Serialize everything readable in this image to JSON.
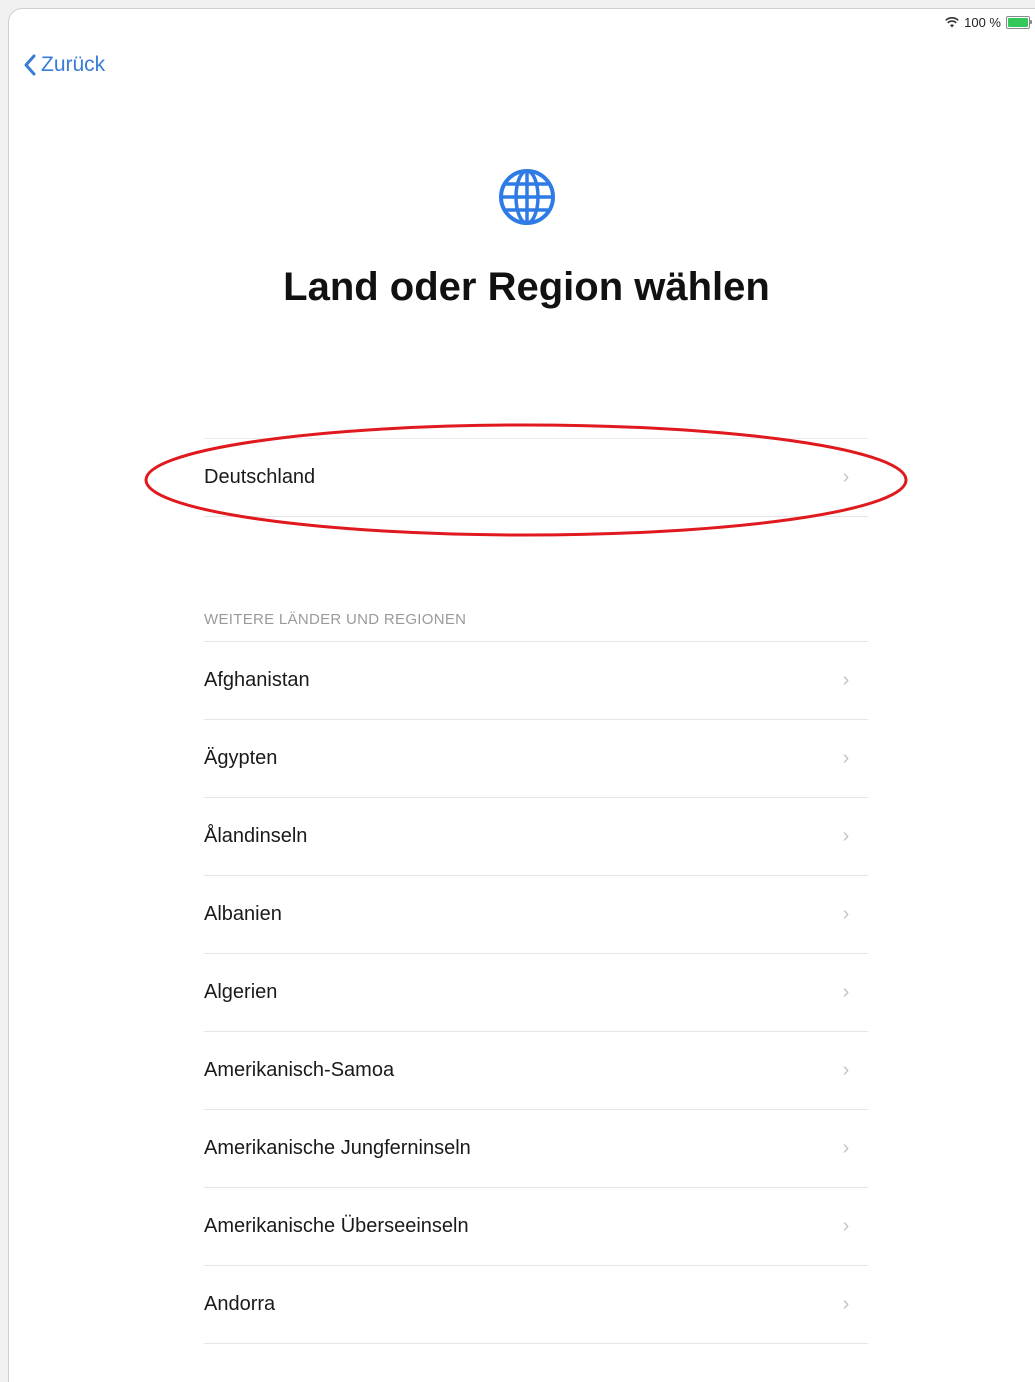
{
  "status_bar": {
    "battery_text": "100 %",
    "battery_level": 1.0,
    "wifi_icon": "wifi-icon",
    "battery_icon": "battery-icon",
    "battery_color": "#34c759"
  },
  "nav": {
    "back_label": "Zurück",
    "back_icon": "chevron-left-icon",
    "accent_color": "#3a7bd5"
  },
  "header": {
    "icon": "globe-icon",
    "title": "Land oder Region wählen"
  },
  "suggested": {
    "items": [
      {
        "label": "Deutschland"
      }
    ],
    "highlight_color": "#e0191f"
  },
  "more_regions": {
    "section_title": "WEITERE LÄNDER UND REGIONEN",
    "items": [
      {
        "label": "Afghanistan"
      },
      {
        "label": "Ägypten"
      },
      {
        "label": "Ålandinseln"
      },
      {
        "label": "Albanien"
      },
      {
        "label": "Algerien"
      },
      {
        "label": "Amerikanisch-Samoa"
      },
      {
        "label": "Amerikanische Jungferninseln"
      },
      {
        "label": "Amerikanische Überseeinseln"
      },
      {
        "label": "Andorra"
      }
    ]
  }
}
